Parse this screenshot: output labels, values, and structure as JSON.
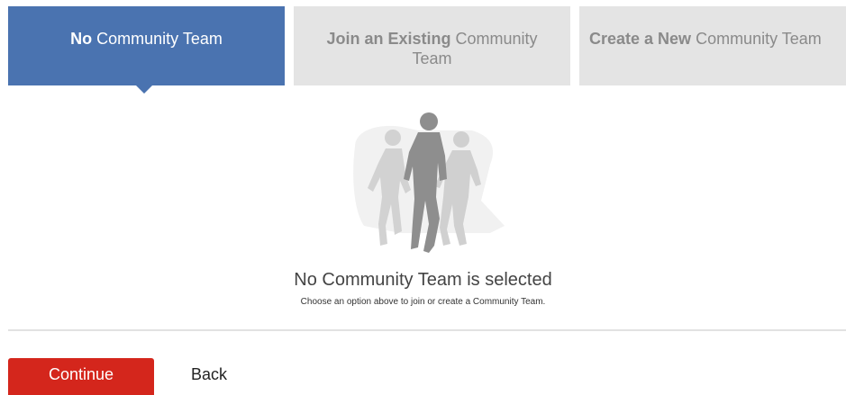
{
  "tabs": [
    {
      "bold": "No",
      "rest": " Community Team",
      "active": true
    },
    {
      "bold": "Join an Existing",
      "rest": " Community",
      "line2": "Team",
      "active": false
    },
    {
      "bold": "Create a New",
      "rest": " Community Team",
      "active": false
    }
  ],
  "illustration": {
    "icon": "runners-silhouette-icon"
  },
  "empty_state": {
    "title": "No Community Team is selected",
    "subtitle": "Choose an option above to join or create a Community Team."
  },
  "actions": {
    "continue_label": "Continue",
    "back_label": "Back"
  },
  "colors": {
    "active_tab": "#4a73b0",
    "inactive_tab": "#e4e4e4",
    "primary_button": "#d4261c"
  }
}
